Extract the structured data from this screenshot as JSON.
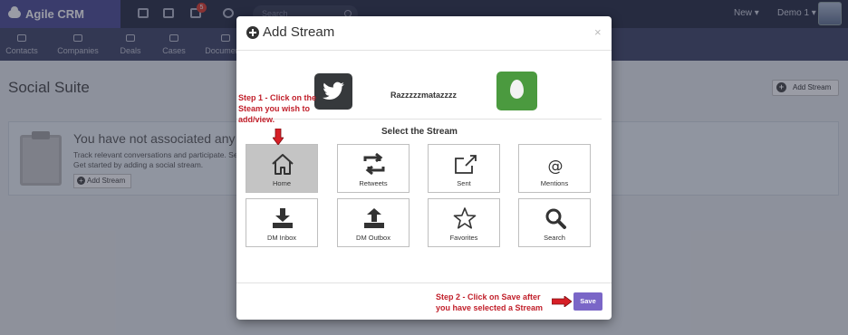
{
  "app": {
    "brand": "Agile CRM",
    "notifications_count": "5"
  },
  "topbar": {
    "search_placeholder": "Search",
    "new_label": "New ▾",
    "user_label": "Demo 1 ▾"
  },
  "nav": {
    "items": [
      "Contacts",
      "Companies",
      "Deals",
      "Cases",
      "Documents"
    ]
  },
  "page": {
    "title": "Social Suite",
    "add_stream_label": "Add Stream"
  },
  "empty_state": {
    "title": "You have not associated any social",
    "line1": "Track relevant conversations and participate. Se",
    "line2": "Get started by adding a social stream.",
    "button": "Add Stream"
  },
  "modal": {
    "title": "Add Stream",
    "close": "×",
    "account_name": "Razzzzzmatazzzz",
    "select_title": "Select the Stream",
    "streams": [
      {
        "label": "Home",
        "icon": "home-icon",
        "selected": true
      },
      {
        "label": "Retweets",
        "icon": "retweet-icon",
        "selected": false
      },
      {
        "label": "Sent",
        "icon": "share-icon",
        "selected": false
      },
      {
        "label": "Mentions",
        "icon": "at-icon",
        "selected": false
      },
      {
        "label": "DM Inbox",
        "icon": "inbox-download-icon",
        "selected": false
      },
      {
        "label": "DM Outbox",
        "icon": "outbox-upload-icon",
        "selected": false
      },
      {
        "label": "Favorites",
        "icon": "star-icon",
        "selected": false
      },
      {
        "label": "Search",
        "icon": "search-icon",
        "selected": false
      }
    ],
    "save_label": "Save"
  },
  "callouts": {
    "step1_line1": "Step 1 - Click on the",
    "step1_line2": "Steam you wish to",
    "step1_line3": "add/view.",
    "step2_line1": "Step 2 - Click on Save after",
    "step2_line2": "you have selected a Stream"
  },
  "colors": {
    "accent": "#7a66c7",
    "callout": "#c11f2a",
    "twitter_box": "#36393c",
    "avatar_green": "#4b9a3f"
  }
}
